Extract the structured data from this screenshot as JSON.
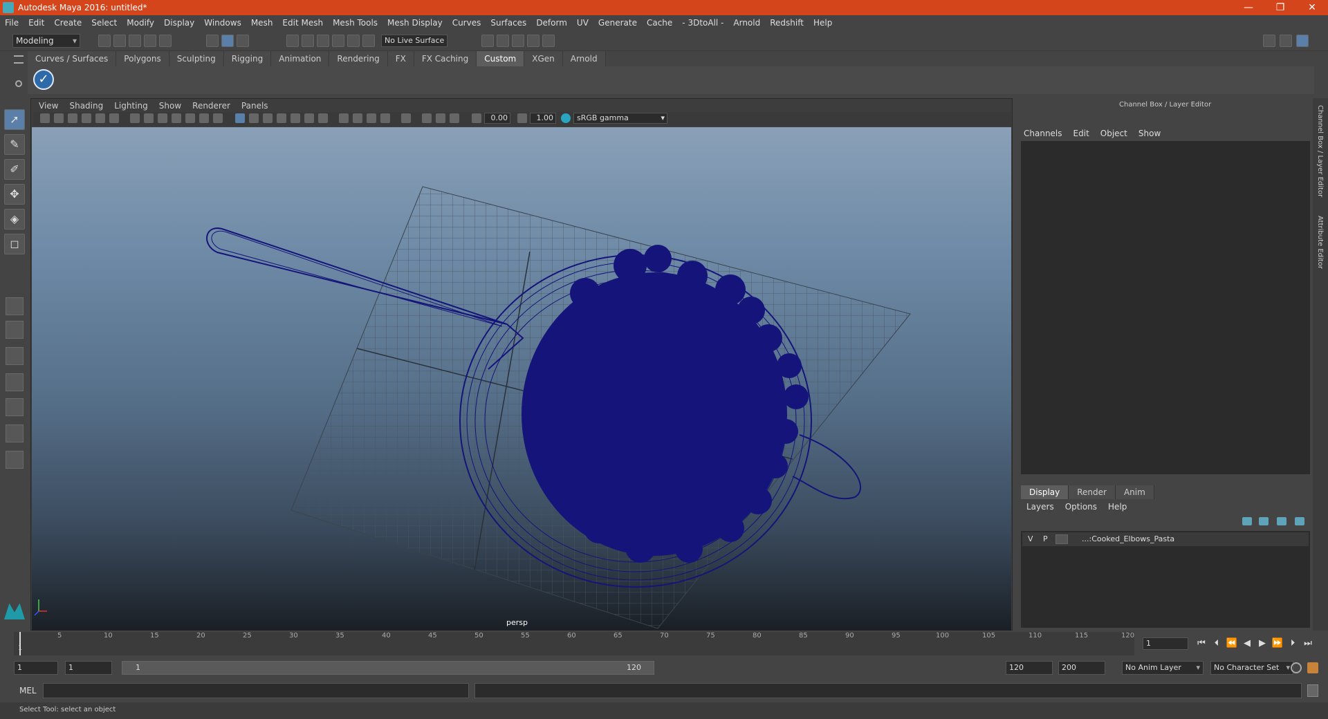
{
  "app": {
    "title": "Autodesk Maya 2016: untitled*"
  },
  "window_controls": {
    "minimize": "—",
    "restore": "❐",
    "close": "✕"
  },
  "menubar": [
    "File",
    "Edit",
    "Create",
    "Select",
    "Modify",
    "Display",
    "Windows",
    "Mesh",
    "Edit Mesh",
    "Mesh Tools",
    "Mesh Display",
    "Curves",
    "Surfaces",
    "Deform",
    "UV",
    "Generate",
    "Cache",
    "- 3DtoAll -",
    "Arnold",
    "Redshift",
    "Help"
  ],
  "statusline": {
    "mode": "Modeling",
    "live_surface": "No Live Surface"
  },
  "shelf": {
    "tabs": [
      "Curves / Surfaces",
      "Polygons",
      "Sculpting",
      "Rigging",
      "Animation",
      "Rendering",
      "FX",
      "FX Caching",
      "Custom",
      "XGen",
      "Arnold"
    ],
    "active_tab": "Custom",
    "icon_glyph": "✓"
  },
  "viewport": {
    "menu": [
      "View",
      "Shading",
      "Lighting",
      "Show",
      "Renderer",
      "Panels"
    ],
    "exposure": "0.00",
    "gamma": "1.00",
    "color_space": "sRGB gamma",
    "camera_label": "persp"
  },
  "channel_box": {
    "title": "Channel Box / Layer Editor",
    "menu": [
      "Channels",
      "Edit",
      "Object",
      "Show"
    ]
  },
  "layer_editor": {
    "tabs": [
      "Display",
      "Render",
      "Anim"
    ],
    "active_tab": "Display",
    "menu": [
      "Layers",
      "Options",
      "Help"
    ],
    "layers": [
      {
        "v": "V",
        "p": "P",
        "name": "...:Cooked_Elbows_Pasta"
      }
    ]
  },
  "side_tabs": {
    "channel_box": "Channel Box / Layer Editor",
    "attribute_editor": "Attribute Editor"
  },
  "timeline": {
    "labels": [
      "5",
      "10",
      "15",
      "20",
      "25",
      "30",
      "35",
      "40",
      "45",
      "50",
      "55",
      "60",
      "65",
      "70",
      "75",
      "80",
      "85",
      "90",
      "95",
      "100",
      "105",
      "110",
      "115",
      "120"
    ],
    "start_label": "1",
    "current_frame": "1"
  },
  "range": {
    "start": "1",
    "playback_start": "1",
    "slider_start": "1",
    "slider_end": "120",
    "playback_end": "120",
    "end": "200",
    "anim_layer": "No Anim Layer",
    "character_set": "No Character Set"
  },
  "playback_icons": [
    "⏮",
    "⏴",
    "⏪",
    "◀",
    "▶",
    "⏩",
    "⏵",
    "⏭"
  ],
  "mel": {
    "label": "MEL"
  },
  "help_line": "Select Tool: select an object",
  "colors": {
    "title_bar": "#d4451c",
    "wireframe": "#14147a",
    "panel": "#444444"
  }
}
